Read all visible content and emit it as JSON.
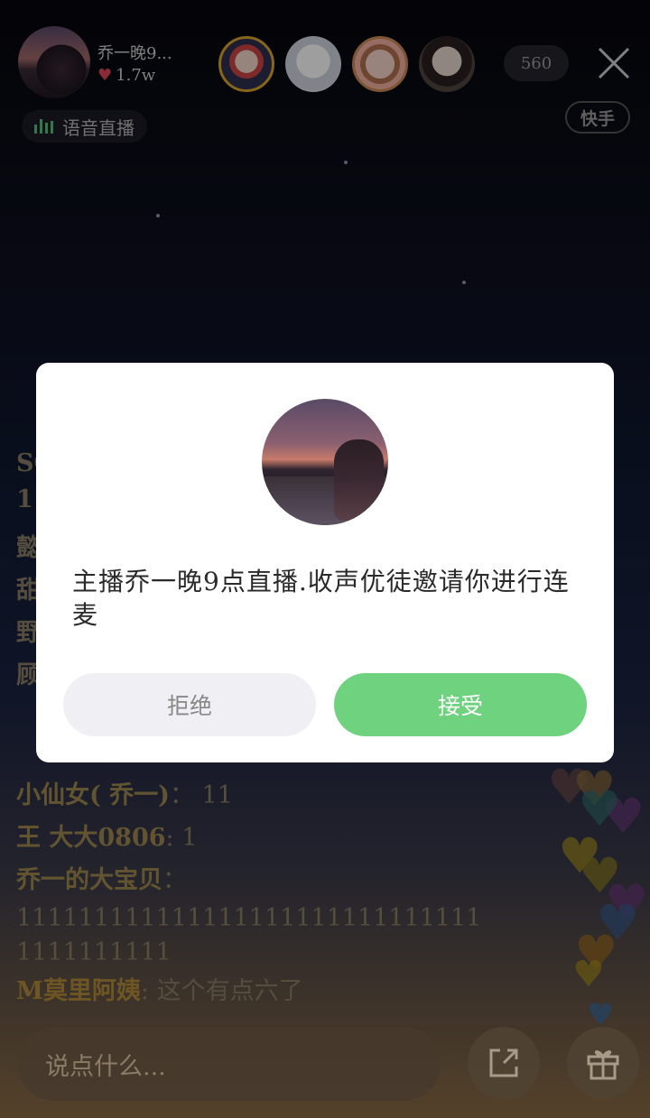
{
  "header": {
    "host_name": "乔一晚9...",
    "likes": "1.7w",
    "viewer_count": "560",
    "voice_badge_label": "语音直播",
    "platform_badge": "快手"
  },
  "chat": {
    "partial_lines": [
      "SC",
      "11",
      "懿",
      "甜",
      "野",
      "顾"
    ],
    "messages": [
      {
        "name": "小仙女( 乔一)",
        "text": "11"
      },
      {
        "name": "王 大大0806",
        "text": "1"
      },
      {
        "name": "乔一的大宝贝",
        "text": ""
      },
      {
        "name": "",
        "text": "111111111111111111111111111111"
      },
      {
        "name": "",
        "text": "1111111111"
      },
      {
        "name": "M莫里阿姨",
        "text": "这个有点六了"
      }
    ]
  },
  "dialog": {
    "message": "主播乔一晚9点直播.收声优徒邀请你进行连麦",
    "reject_label": "拒绝",
    "accept_label": "接受"
  },
  "bottom": {
    "input_placeholder": "说点什么..."
  },
  "colors": {
    "accept": "#6ed27e",
    "heart": "#e0465a",
    "live_bars": "#52c27a"
  }
}
